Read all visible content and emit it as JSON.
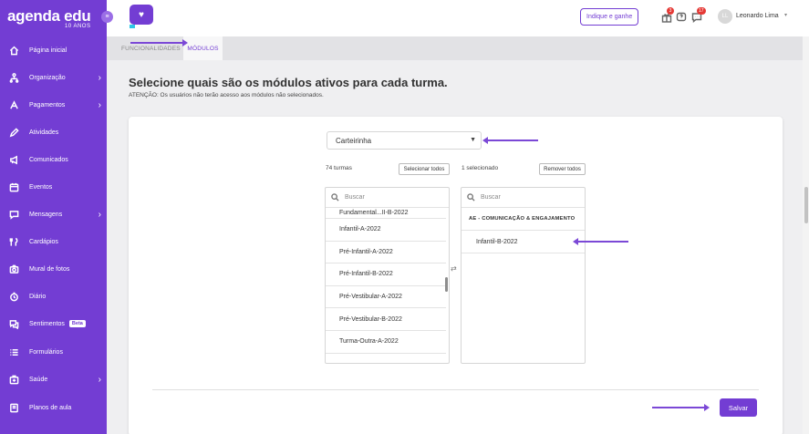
{
  "sidebar": {
    "logo_main": "agenda edu",
    "logo_sub": "10 ANOS",
    "items": [
      {
        "label": "Página inicial",
        "icon": "home-icon",
        "chevron": false
      },
      {
        "label": "Organização",
        "icon": "org-icon",
        "chevron": true
      },
      {
        "label": "Pagamentos",
        "icon": "payments-icon",
        "chevron": true
      },
      {
        "label": "Atividades",
        "icon": "pencil-icon",
        "chevron": false
      },
      {
        "label": "Comunicados",
        "icon": "megaphone-icon",
        "chevron": false
      },
      {
        "label": "Eventos",
        "icon": "calendar-icon",
        "chevron": false
      },
      {
        "label": "Mensagens",
        "icon": "chat-icon",
        "chevron": true
      },
      {
        "label": "Cardápios",
        "icon": "menu-food-icon",
        "chevron": false
      },
      {
        "label": "Mural de fotos",
        "icon": "camera-icon",
        "chevron": false
      },
      {
        "label": "Diário",
        "icon": "clock-icon",
        "chevron": false
      },
      {
        "label": "Sentimentos",
        "icon": "feelings-icon",
        "chevron": false,
        "badge": "Beta"
      },
      {
        "label": "Formulários",
        "icon": "list-icon",
        "chevron": false
      },
      {
        "label": "Saúde",
        "icon": "health-icon",
        "chevron": true
      },
      {
        "label": "Planos de aula",
        "icon": "book-icon",
        "chevron": false
      }
    ]
  },
  "header": {
    "indique_label": "Indique e ganhe",
    "gift_badge": "3",
    "messages_badge": "17",
    "avatar_initials": "LL",
    "user_name": "Leonardo Lima"
  },
  "tabs": {
    "funcionalidades": "FUNCIONALIDADES",
    "modulos": "MÓDULOS"
  },
  "main": {
    "title": "Selecione quais são os módulos ativos para cada turma.",
    "note": "ATENÇÃO: Os usuários não terão acesso aos módulos não selecionados.",
    "module_select": "Carteirinha",
    "left_count": "74 turmas",
    "select_all_label": "Selecionar todos",
    "right_count": "1 selecionado",
    "remove_all_label": "Remover todos",
    "search_placeholder": "Buscar",
    "available_classes": [
      "Fundamental...II-B-2022",
      "Infantil-A-2022",
      "Pré-Infantil-A-2022",
      "Pré-Infantil-B-2022",
      "Pré-Vestibular-A-2022",
      "Pré-Vestibular-B-2022",
      "Turma-Outra-A-2022"
    ],
    "selected_group_title": "AE - COMUNICAÇÃO & ENGAJAMENTO",
    "selected_classes": [
      "Infantil-B-2022"
    ],
    "save_label": "Salvar"
  },
  "colors": {
    "brand": "#733dd3",
    "badge": "#e53935"
  }
}
